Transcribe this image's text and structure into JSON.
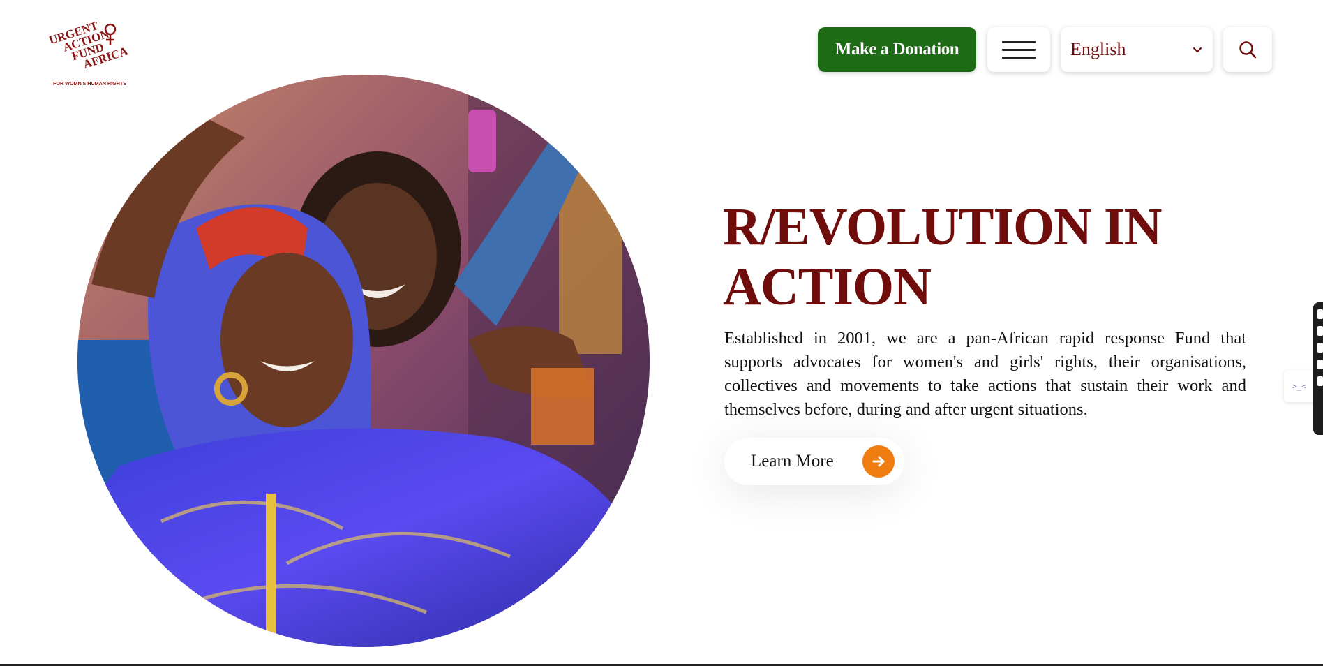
{
  "header": {
    "logo": {
      "lines": [
        "URGENT",
        "ACTION",
        "FUND",
        "AFRICA"
      ],
      "tagline": "FOR WOMN'S HUMAN RIGHTS"
    },
    "donate_label": "Make a Donation",
    "language": {
      "selected": "English"
    }
  },
  "hero": {
    "title": "R/EVOLUTION IN ACTION",
    "description": "Established in 2001, we are a pan-African rapid response Fund that supports advocates for women's and girls' rights, their organisations, collectives and movements to take actions that sustain their work and themselves before, during and after urgent situations.",
    "cta_label": "Learn More"
  },
  "side_tab": {
    "label": ">_<"
  },
  "colors": {
    "brand_maroon": "#6f0c0c",
    "donate_green": "#1e6b16",
    "cta_orange": "#f07d12"
  },
  "icons": [
    "hamburger-menu-icon",
    "chevron-down-icon",
    "search-icon",
    "arrow-right-icon"
  ]
}
